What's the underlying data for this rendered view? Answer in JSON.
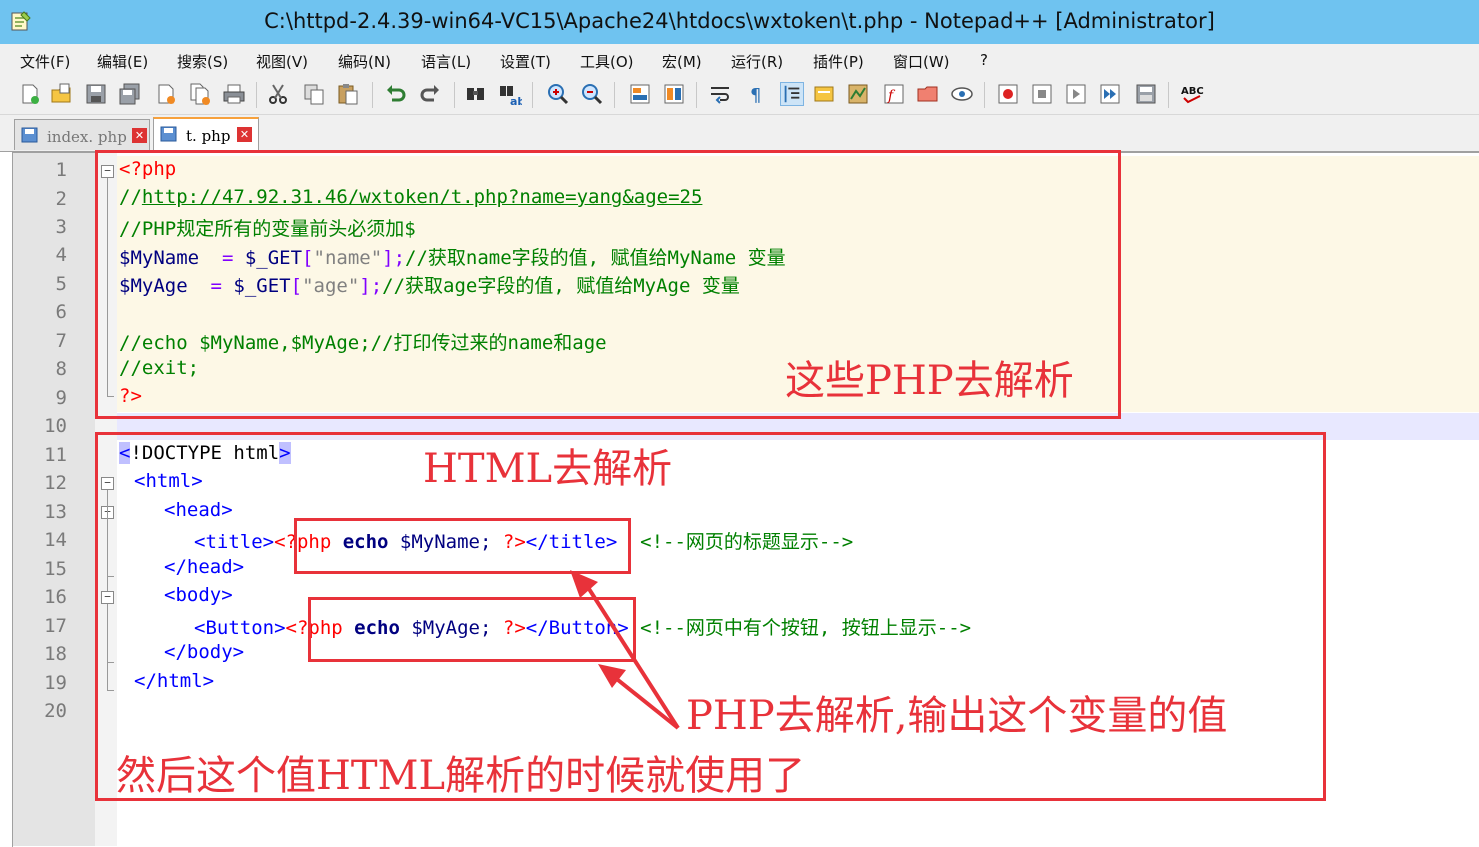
{
  "window": {
    "title": "C:\\httpd-2.4.39-win64-VC15\\Apache24\\htdocs\\wxtoken\\t.php - Notepad++ [Administrator]"
  },
  "menu": [
    "文件(F)",
    "编辑(E)",
    "搜索(S)",
    "视图(V)",
    "编码(N)",
    "语言(L)",
    "设置(T)",
    "工具(O)",
    "宏(M)",
    "运行(R)",
    "插件(P)",
    "窗口(W)",
    "?"
  ],
  "toolbar_icons": [
    "new-file-icon",
    "open-file-icon",
    "save-icon",
    "save-all-icon",
    "close-icon",
    "close-all-icon",
    "print-icon",
    "cut-icon",
    "copy-icon",
    "paste-icon",
    "undo-icon",
    "redo-icon",
    "find-icon",
    "replace-icon",
    "zoom-in-icon",
    "zoom-out-icon",
    "sync-vertical-icon",
    "sync-horizontal-icon",
    "word-wrap-icon",
    "show-all-chars-icon",
    "indent-guide-icon",
    "lang-define-icon",
    "doc-map-icon",
    "function-list-icon",
    "folder-workspace-icon",
    "monitoring-icon",
    "record-macro-icon",
    "stop-record-icon",
    "play-macro-icon",
    "run-macro-multiple-icon",
    "save-macro-icon",
    "spell-check-icon"
  ],
  "tabs": [
    {
      "label": "index. php",
      "active": false
    },
    {
      "label": "t. php",
      "active": true
    }
  ],
  "line_numbers": [
    "1",
    "2",
    "3",
    "4",
    "5",
    "6",
    "7",
    "8",
    "9",
    "10",
    "11",
    "12",
    "13",
    "14",
    "15",
    "16",
    "17",
    "18",
    "19",
    "20"
  ],
  "code": {
    "l1": "<?php",
    "l2_a": "//",
    "l2_b": "http://47.92.31.46/wxtoken/t.php?name=yang&age=25",
    "l3": "//PHP规定所有的变量前头必须加$",
    "l4_var": "$MyName",
    "l4_op": "  = ",
    "l4_get": "$_GET",
    "l4_b1": "[",
    "l4_str": "\"name\"",
    "l4_b2": "];",
    "l4_cm": "//获取name字段的值, 赋值给MyName 变量",
    "l5_var": "$MyAge",
    "l5_op": "  = ",
    "l5_get": "$_GET",
    "l5_b1": "[",
    "l5_str": "\"age\"",
    "l5_b2": "];",
    "l5_cm": "//获取age字段的值, 赋值给MyAge 变量",
    "l7": "//echo $MyName,$MyAge;//打印传过来的name和age",
    "l8": "//exit;",
    "l9": "?>",
    "l11_a": "<",
    "l11_b": "!DOCTYPE html",
    "l11_c": ">",
    "l12": "<html>",
    "l13": "<head>",
    "l14_a": "<title>",
    "l14_b": "<?php",
    "l14_c": " echo ",
    "l14_d": "$MyName; ",
    "l14_e": "?>",
    "l14_f": "</title>",
    "l14_g": "<!--网页的标题显示-->",
    "l15": "</head>",
    "l16": "<body>",
    "l17_a": "<Button>",
    "l17_b": "<?php",
    "l17_c": " echo ",
    "l17_d": "$MyAge; ",
    "l17_e": "?>",
    "l17_f": "</Button>",
    "l17_g": "<!--网页中有个按钮, 按钮上显示-->",
    "l18": "</body>",
    "l19": "</html>"
  },
  "annotations": {
    "php_parse": "这些PHP去解析",
    "html_parse": "HTML去解析",
    "php_output": "PHP去解析,输出这个变量的值",
    "html_use": "然后这个值HTML解析的时候就使用了"
  },
  "colors": {
    "annotation_red": "#e8323a",
    "titlebar_blue": "#6fc3f0",
    "comment_green": "#008000",
    "tag_blue": "#0000ff",
    "php_red": "#ff0000"
  }
}
